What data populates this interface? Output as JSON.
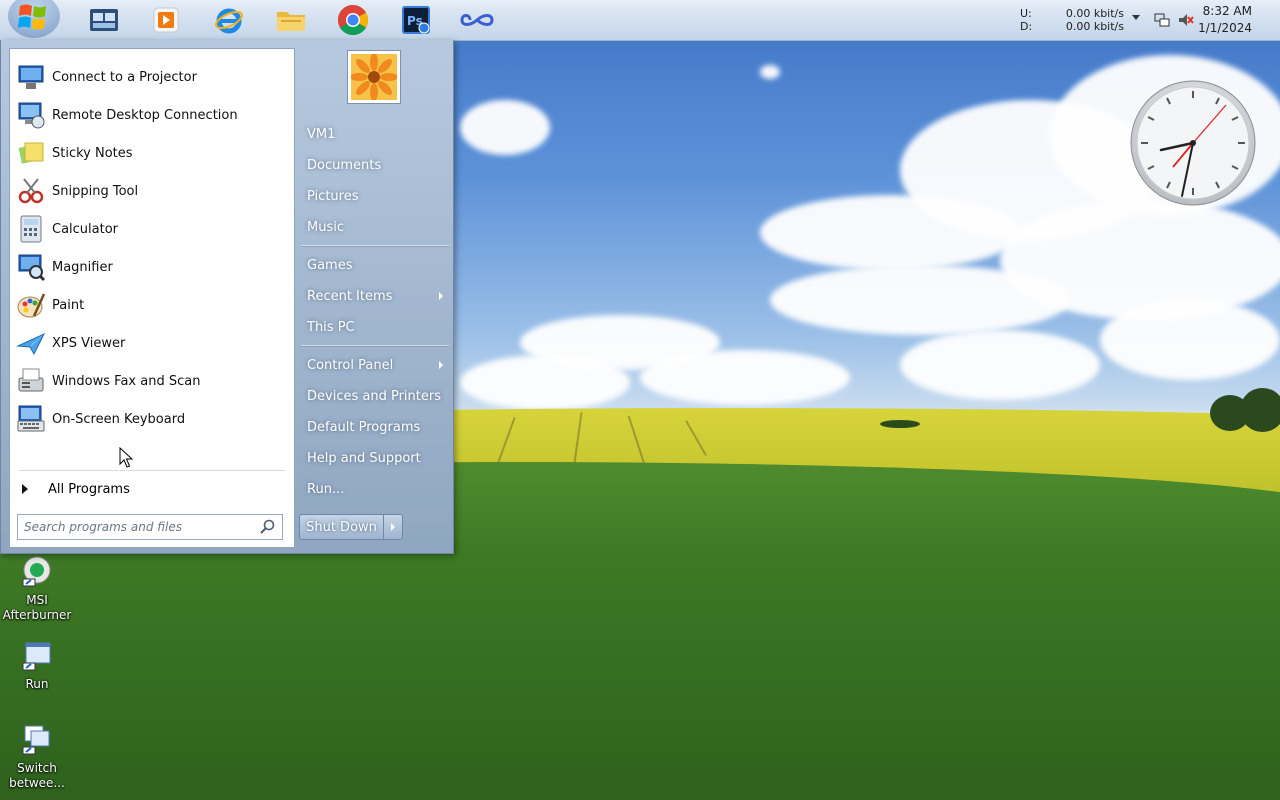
{
  "taskbar": {
    "pinned": [
      "windows-explorer-icon",
      "media-player-icon",
      "internet-explorer-icon",
      "file-explorer-icon",
      "chrome-icon",
      "photoshop-icon",
      "infinity-app-icon"
    ],
    "tray": {
      "upload_label": "U:",
      "download_label": "D:",
      "upload_value": "0.00 kbit/s",
      "download_value": "0.00 kbit/s",
      "time": "8:32 AM",
      "date": "1/1/2024"
    }
  },
  "start_menu": {
    "programs": [
      {
        "label": "Connect to a Projector",
        "icon": "projector-icon"
      },
      {
        "label": "Remote Desktop Connection",
        "icon": "remote-desktop-icon"
      },
      {
        "label": "Sticky Notes",
        "icon": "sticky-notes-icon"
      },
      {
        "label": "Snipping Tool",
        "icon": "scissors-icon"
      },
      {
        "label": "Calculator",
        "icon": "calculator-icon"
      },
      {
        "label": "Magnifier",
        "icon": "magnifier-icon"
      },
      {
        "label": "Paint",
        "icon": "paint-palette-icon"
      },
      {
        "label": "XPS Viewer",
        "icon": "xps-viewer-icon"
      },
      {
        "label": "Windows Fax and Scan",
        "icon": "fax-icon"
      },
      {
        "label": "On-Screen Keyboard",
        "icon": "keyboard-icon"
      }
    ],
    "all_programs": "All Programs",
    "search_placeholder": "Search programs and files",
    "right_items": [
      {
        "label": "VM1"
      },
      {
        "label": "Documents"
      },
      {
        "label": "Pictures"
      },
      {
        "label": "Music"
      },
      {
        "label": "Games"
      },
      {
        "label": "Recent Items",
        "submenu": true
      },
      {
        "label": "This PC"
      },
      {
        "label": "Control Panel",
        "submenu": true
      },
      {
        "label": "Devices and Printers"
      },
      {
        "label": "Default Programs"
      },
      {
        "label": "Help and Support"
      },
      {
        "label": "Run..."
      }
    ],
    "shutdown_label": "Shut Down"
  },
  "desktop_icons": [
    {
      "label": "MSI Afterburner",
      "icon": "msi-afterburner-icon"
    },
    {
      "label": "Run",
      "icon": "run-icon"
    },
    {
      "label": "Switch betwee...",
      "icon": "switch-windows-icon"
    }
  ],
  "colors": {
    "menu_right_pane": "#9fb3cc",
    "accent_orange": "#f08a1c"
  }
}
